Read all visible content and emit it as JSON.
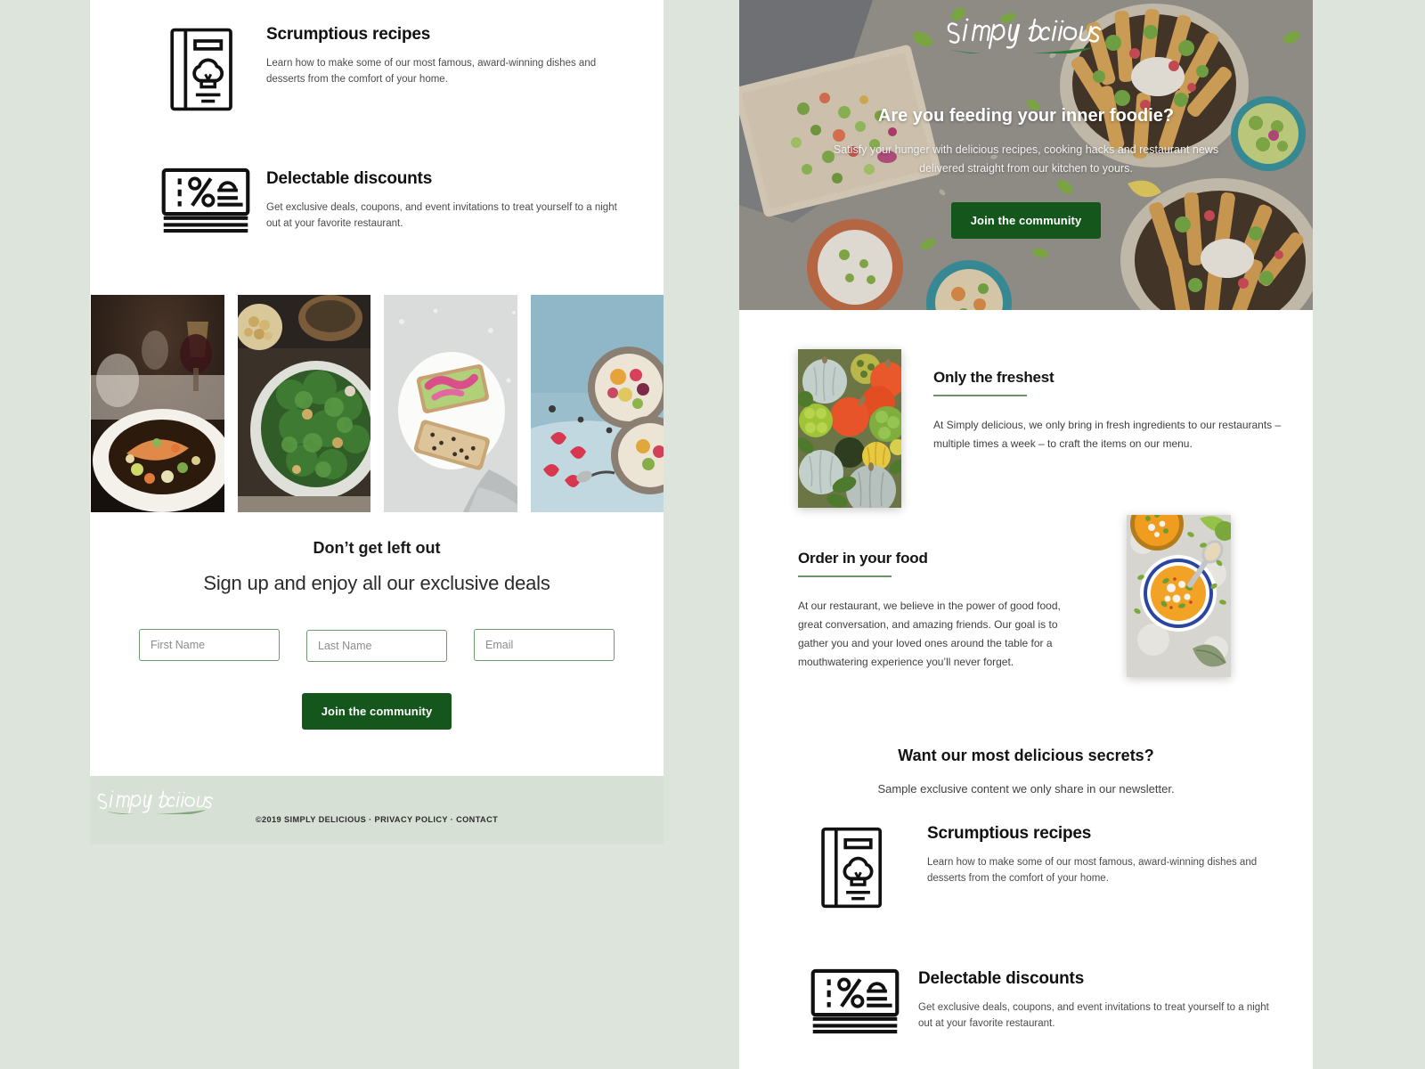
{
  "brand": {
    "name": "simply delicious",
    "accent_green": "#14561B",
    "rule_green": "#6B9468",
    "page_background": "#DCE4DC",
    "footer_background": "#D6E0D4"
  },
  "left_panel": {
    "features": [
      {
        "icon": "recipe-book-icon",
        "title": "Scrumptious recipes",
        "description": "Learn how to make some of our most famous, award-winning dishes and desserts from the comfort of your home."
      },
      {
        "icon": "discount-ticket-icon",
        "title": "Delectable discounts",
        "description": "Get exclusive deals, coupons, and event invitations to treat yourself to a night out at your favorite restaurant."
      }
    ],
    "gallery": [
      {
        "name": "salmon-plate-photo",
        "alt": "Salmon dish with wine glasses on a dark dinner table"
      },
      {
        "name": "kale-salad-photo",
        "alt": "Kale and chickpea salad in a ceramic bowl"
      },
      {
        "name": "avocado-toast-photo",
        "alt": "Avocado toast with pickled onions on a white plate"
      },
      {
        "name": "breakfast-bowl-photo",
        "alt": "Yogurt bowls with berries on a blue surface"
      }
    ],
    "signup": {
      "kicker": "Don’t get left out",
      "headline": "Sign up and enjoy all our exclusive deals",
      "first_name_placeholder": "First Name",
      "last_name_placeholder": "Last Name",
      "email_placeholder": "Email",
      "first_name_value": "",
      "last_name_value": "",
      "email_value": "",
      "submit_label": "Join the community"
    },
    "footer": {
      "logo": "simply delicious",
      "copyright": "©2019 SIMPLY DELICIOUS · PRIVACY POLICY · CONTACT"
    }
  },
  "right_panel": {
    "hero": {
      "logo": "simply delicious",
      "title": "Are you feeding your inner foodie?",
      "subtitle": "Satisfy your hunger with delicious recipes, cooking hacks and restaurant news delivered straight from our kitchen to yours.",
      "cta_label": "Join the community",
      "background_photo": "overhead-loaded-fries-photo"
    },
    "sections": [
      {
        "id": "only-the-freshest",
        "heading": "Only the freshest",
        "body": "At Simply delicious, we only bring in fresh ingredients to our restaurants – multiple times a week – to craft the items on our menu.",
        "image": "squash-assortment-photo"
      },
      {
        "id": "order-in-your-food",
        "heading": "Order in your food",
        "body": "At our restaurant, we believe in the power of good food, great conversation, and amazing friends. Our goal is to gather you and your loved ones around the table for a mouthwatering experience you’ll never forget.",
        "image": "pumpkin-soup-bowls-photo"
      }
    ],
    "secrets": {
      "title": "Want our most delicious secrets?",
      "subtitle": "Sample exclusive content we only share in our newsletter."
    },
    "features": [
      {
        "icon": "recipe-book-icon",
        "title": "Scrumptious recipes",
        "description": "Learn how to make some of our most famous, award-winning dishes and desserts from the comfort of your home."
      },
      {
        "icon": "discount-ticket-icon",
        "title": "Delectable discounts",
        "description": "Get exclusive deals, coupons, and event invitations to treat yourself to a night out at your favorite restaurant."
      }
    ]
  }
}
